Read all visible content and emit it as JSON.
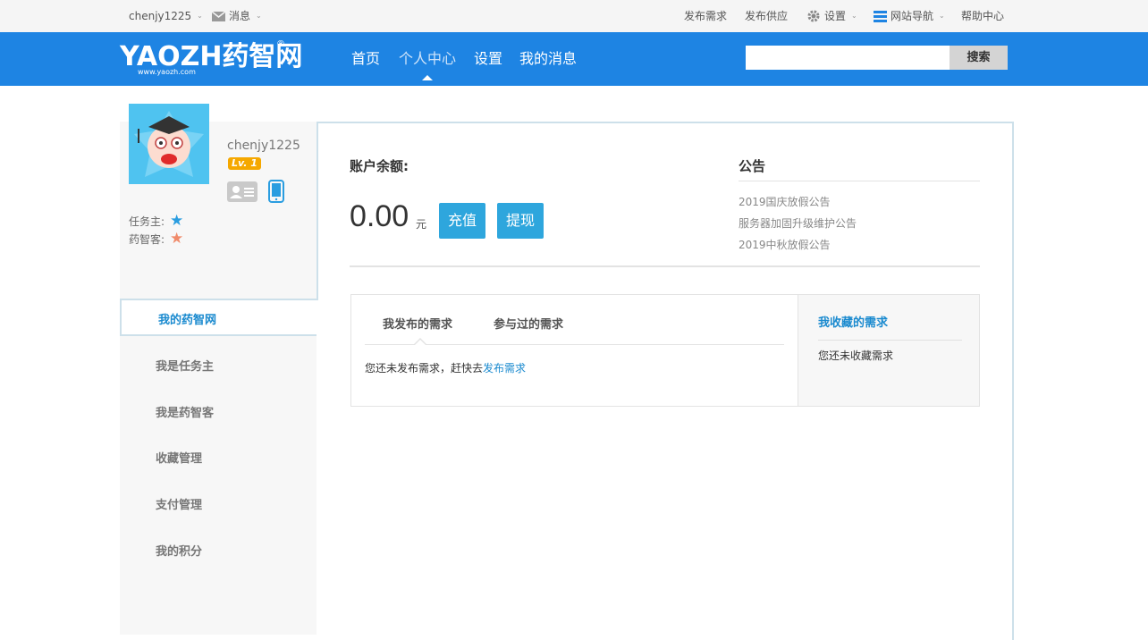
{
  "topbar": {
    "username": "chenjy1225",
    "messages": "消息",
    "publish_demand": "发布需求",
    "publish_supply": "发布供应",
    "settings": "设置",
    "site_nav": "网站导航",
    "help": "帮助中心"
  },
  "header": {
    "logo_text": "YAOZH药智网",
    "logo_url_text": "www.yaozh.com",
    "logo_reg": "®",
    "nav": [
      "首页",
      "个人中心",
      "设置",
      "我的消息"
    ],
    "active_nav": "个人中心",
    "search_placeholder": "",
    "search_button": "搜索"
  },
  "profile": {
    "username": "chenjy1225",
    "level": "Lv. 1",
    "roles": [
      {
        "label": "任务主:",
        "color": "#2a9de0"
      },
      {
        "label": "药智客:",
        "color": "#f08a6a"
      }
    ]
  },
  "sidebar": {
    "active": "我的药智网",
    "items": [
      "我是任务主",
      "我是药智客",
      "收藏管理",
      "支付管理",
      "我的积分"
    ]
  },
  "account": {
    "balance_label": "账户余额:",
    "balance": "0.00",
    "unit": "元",
    "recharge": "充值",
    "withdraw": "提现"
  },
  "notice": {
    "title": "公告",
    "items": [
      "2019国庆放假公告",
      "服务器加固升级维护公告",
      "2019中秋放假公告"
    ]
  },
  "demands": {
    "tabs": [
      "我发布的需求",
      "参与过的需求"
    ],
    "empty_text": "您还未发布需求，赶快去",
    "empty_link": "发布需求",
    "favorites_title": "我收藏的需求",
    "favorites_empty": "您还未收藏需求"
  },
  "colors": {
    "brand_blue": "#1e84e3",
    "button_blue": "#2ea6dd",
    "link_blue": "#1a8acf",
    "badge_orange": "#f5a800"
  }
}
